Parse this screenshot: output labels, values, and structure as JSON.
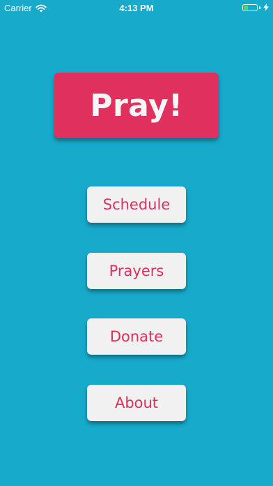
{
  "status_bar": {
    "carrier": "Carrier",
    "time": "4:13 PM",
    "battery_level": 0.4,
    "charging": true
  },
  "main": {
    "pray_label": "Pray!",
    "buttons": {
      "schedule": "Schedule",
      "prayers": "Prayers",
      "donate": "Donate",
      "about": "About"
    }
  },
  "colors": {
    "background": "#17aacb",
    "primary_button": "#e0305e",
    "secondary_button": "#f1f1f2",
    "accent_text": "#df2f5c"
  },
  "icons": [
    "wifi-icon",
    "battery-icon",
    "bolt-icon"
  ]
}
